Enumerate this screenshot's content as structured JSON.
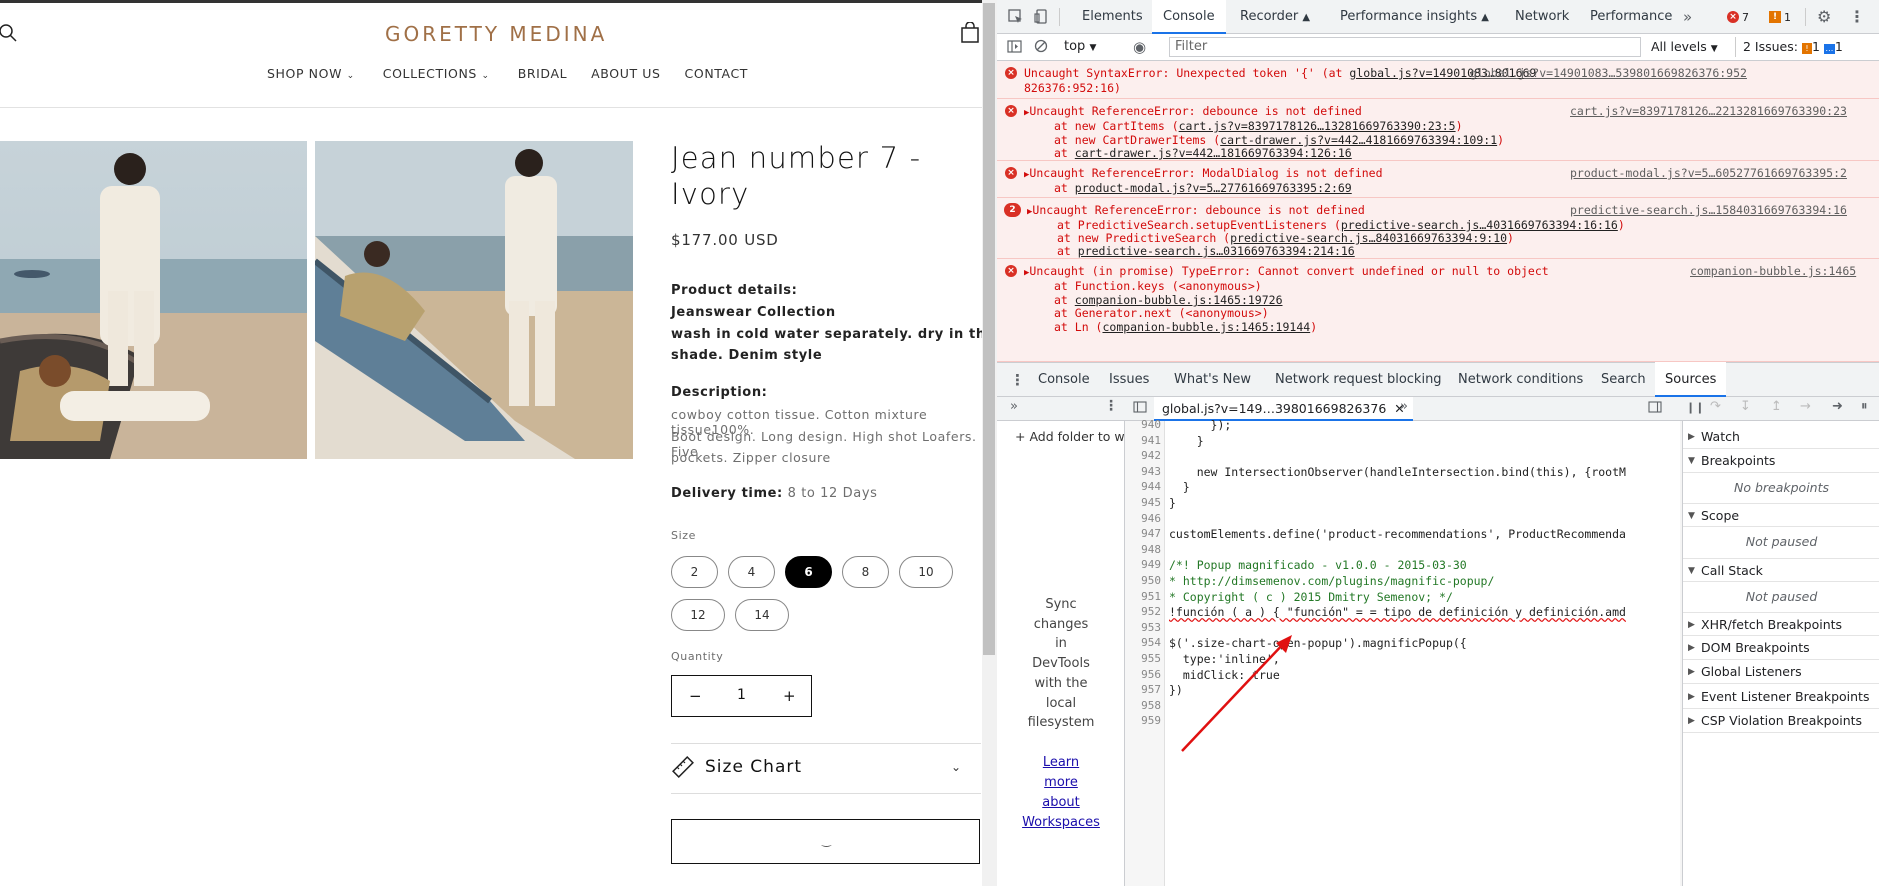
{
  "store": {
    "brand": "GORETTY MEDINA",
    "nav": [
      {
        "label": "SHOP NOW",
        "dropdown": true
      },
      {
        "label": "COLLECTIONS",
        "dropdown": true
      },
      {
        "label": "BRIDAL",
        "dropdown": false
      },
      {
        "label": "ABOUT US",
        "dropdown": false
      },
      {
        "label": "CONTACT",
        "dropdown": false
      }
    ],
    "product": {
      "title_line1": "Jean number 7 -",
      "title_line2": "Ivory",
      "price": "$177.00 USD",
      "details_heading": "Product details:",
      "details_line1": "Jeanswear Collection",
      "details_line2": "wash in cold water separately. dry in the",
      "details_line3": "shade. Denim style",
      "description_heading": "Description:",
      "description_line1": "cowboy cotton tissue. Cotton mixture tissue100%.",
      "description_line2": "Boot design. Long design. High shot Loafers. Five",
      "description_line3": "pockets. Zipper closure",
      "delivery_label": "Delivery time:",
      "delivery_value": "8 to 12 Days",
      "size_label": "Size",
      "sizes": [
        "2",
        "4",
        "6",
        "8",
        "10",
        "12",
        "14"
      ],
      "selected_size": "6",
      "quantity_label": "Quantity",
      "quantity_value": "1",
      "size_chart_label": "Size Chart"
    }
  },
  "devtools": {
    "tabs": [
      "Elements",
      "Console",
      "Recorder",
      "Performance insights",
      "Network",
      "Performance"
    ],
    "active_tab": "Console",
    "error_count": "7",
    "warning_count": "1",
    "console_bar": {
      "context": "top",
      "filter_placeholder": "Filter",
      "levels": "All levels",
      "issues_label": "2 Issues:",
      "issues_warn": "1",
      "issues_info": "1"
    },
    "errors": [
      {
        "line1": "Uncaught SyntaxError: Unexpected token '{' (at ",
        "link1": "global.js?v=14901083…801669",
        "line2": "826376:952:16)",
        "source": "global.js?v=14901083…539801669826376:952"
      },
      {
        "line1": "Uncaught ReferenceError: debounce is not defined",
        "source": "cart.js?v=8397178126…2213281669763390:23",
        "stack": [
          {
            "pre": "at new CartItems (",
            "link": "cart.js?v=8397178126…13281669763390:23:5",
            "post": ")"
          },
          {
            "pre": "at new CartDrawerItems (",
            "link": "cart-drawer.js?v=442…4181669763394:109:1",
            "post": ")"
          },
          {
            "pre": "at ",
            "link": "cart-drawer.js?v=442…181669763394:126:16",
            "post": ""
          }
        ]
      },
      {
        "line1": "Uncaught ReferenceError: ModalDialog is not defined",
        "source": "product-modal.js?v=5…60527761669763395:2",
        "stack": [
          {
            "pre": "at ",
            "link": "product-modal.js?v=5…27761669763395:2:69",
            "post": ""
          }
        ]
      },
      {
        "count": "2",
        "line1": "Uncaught ReferenceError: debounce is not defined",
        "source": "predictive-search.js…1584031669763394:16",
        "stack": [
          {
            "pre": "at PredictiveSearch.setupEventListeners (",
            "link": "predictive-search.js…4031669763394:16:16",
            "post": ")"
          },
          {
            "pre": "at new PredictiveSearch (",
            "link": "predictive-search.js…84031669763394:9:10",
            "post": ")"
          },
          {
            "pre": "at ",
            "link": "predictive-search.js…031669763394:214:16",
            "post": ""
          }
        ]
      },
      {
        "line1": "Uncaught (in promise) TypeError: Cannot convert undefined or null to object",
        "source": "companion-bubble.js:1465",
        "stack": [
          {
            "pre": "at Function.keys (<anonymous>)",
            "link": "",
            "post": ""
          },
          {
            "pre": "at ",
            "link": "companion-bubble.js:1465:19726",
            "post": ""
          },
          {
            "pre": "at Generator.next (<anonymous>)",
            "link": "",
            "post": ""
          },
          {
            "pre": "at Ln (",
            "link": "companion-bubble.js:1465:19144",
            "post": ")"
          }
        ]
      }
    ],
    "drawer_tabs": [
      "Console",
      "Issues",
      "What's New",
      "Network request blocking",
      "Network conditions",
      "Search",
      "Sources"
    ],
    "active_drawer_tab": "Sources",
    "file_tab": "global.js?v=149…39801669826376",
    "navigator": {
      "add_folder": "Add folder to w",
      "sync_text": [
        "Sync",
        "changes",
        "in",
        "DevTools",
        "with the",
        "local",
        "filesystem"
      ],
      "learn_link": [
        "Learn",
        "more",
        "about",
        "Workspaces"
      ]
    },
    "code_lines": [
      {
        "n": "940",
        "t": "      });"
      },
      {
        "n": "941",
        "t": "    }"
      },
      {
        "n": "942",
        "t": ""
      },
      {
        "n": "943",
        "t": "    new IntersectionObserver(handleIntersection.bind(this), {rootM"
      },
      {
        "n": "944",
        "t": "  }"
      },
      {
        "n": "945",
        "t": "}"
      },
      {
        "n": "946",
        "t": ""
      },
      {
        "n": "947",
        "t": "customElements.define('product-recommendations', ProductRecommenda"
      },
      {
        "n": "948",
        "t": ""
      },
      {
        "n": "949",
        "t": "/*! Popup magnificado - v1.0.0 - 2015-03-30"
      },
      {
        "n": "950",
        "t": "* http://dimsemenov.com/plugins/magnific-popup/"
      },
      {
        "n": "951",
        "t": "* Copyright ( c ) 2015 Dmitry Semenov; */"
      },
      {
        "n": "952",
        "t": "!función ( a ) { \"función\" = = tipo de definición y definición.amd"
      },
      {
        "n": "953",
        "t": ""
      },
      {
        "n": "954",
        "t": "$('.size-chart-open-popup').magnificPopup({"
      },
      {
        "n": "955",
        "t": "  type:'inline',"
      },
      {
        "n": "956",
        "t": "  midClick: true"
      },
      {
        "n": "957",
        "t": "})"
      },
      {
        "n": "958",
        "t": ""
      },
      {
        "n": "959",
        "t": ""
      }
    ],
    "debugger": {
      "watch": "Watch",
      "breakpoints": "Breakpoints",
      "no_breakpoints": "No breakpoints",
      "scope": "Scope",
      "scope_status": "Not paused",
      "call_stack": "Call Stack",
      "call_stack_status": "Not paused",
      "xhr": "XHR/fetch Breakpoints",
      "dom": "DOM Breakpoints",
      "global": "Global Listeners",
      "event": "Event Listener Breakpoints",
      "csp": "CSP Violation Breakpoints"
    }
  }
}
